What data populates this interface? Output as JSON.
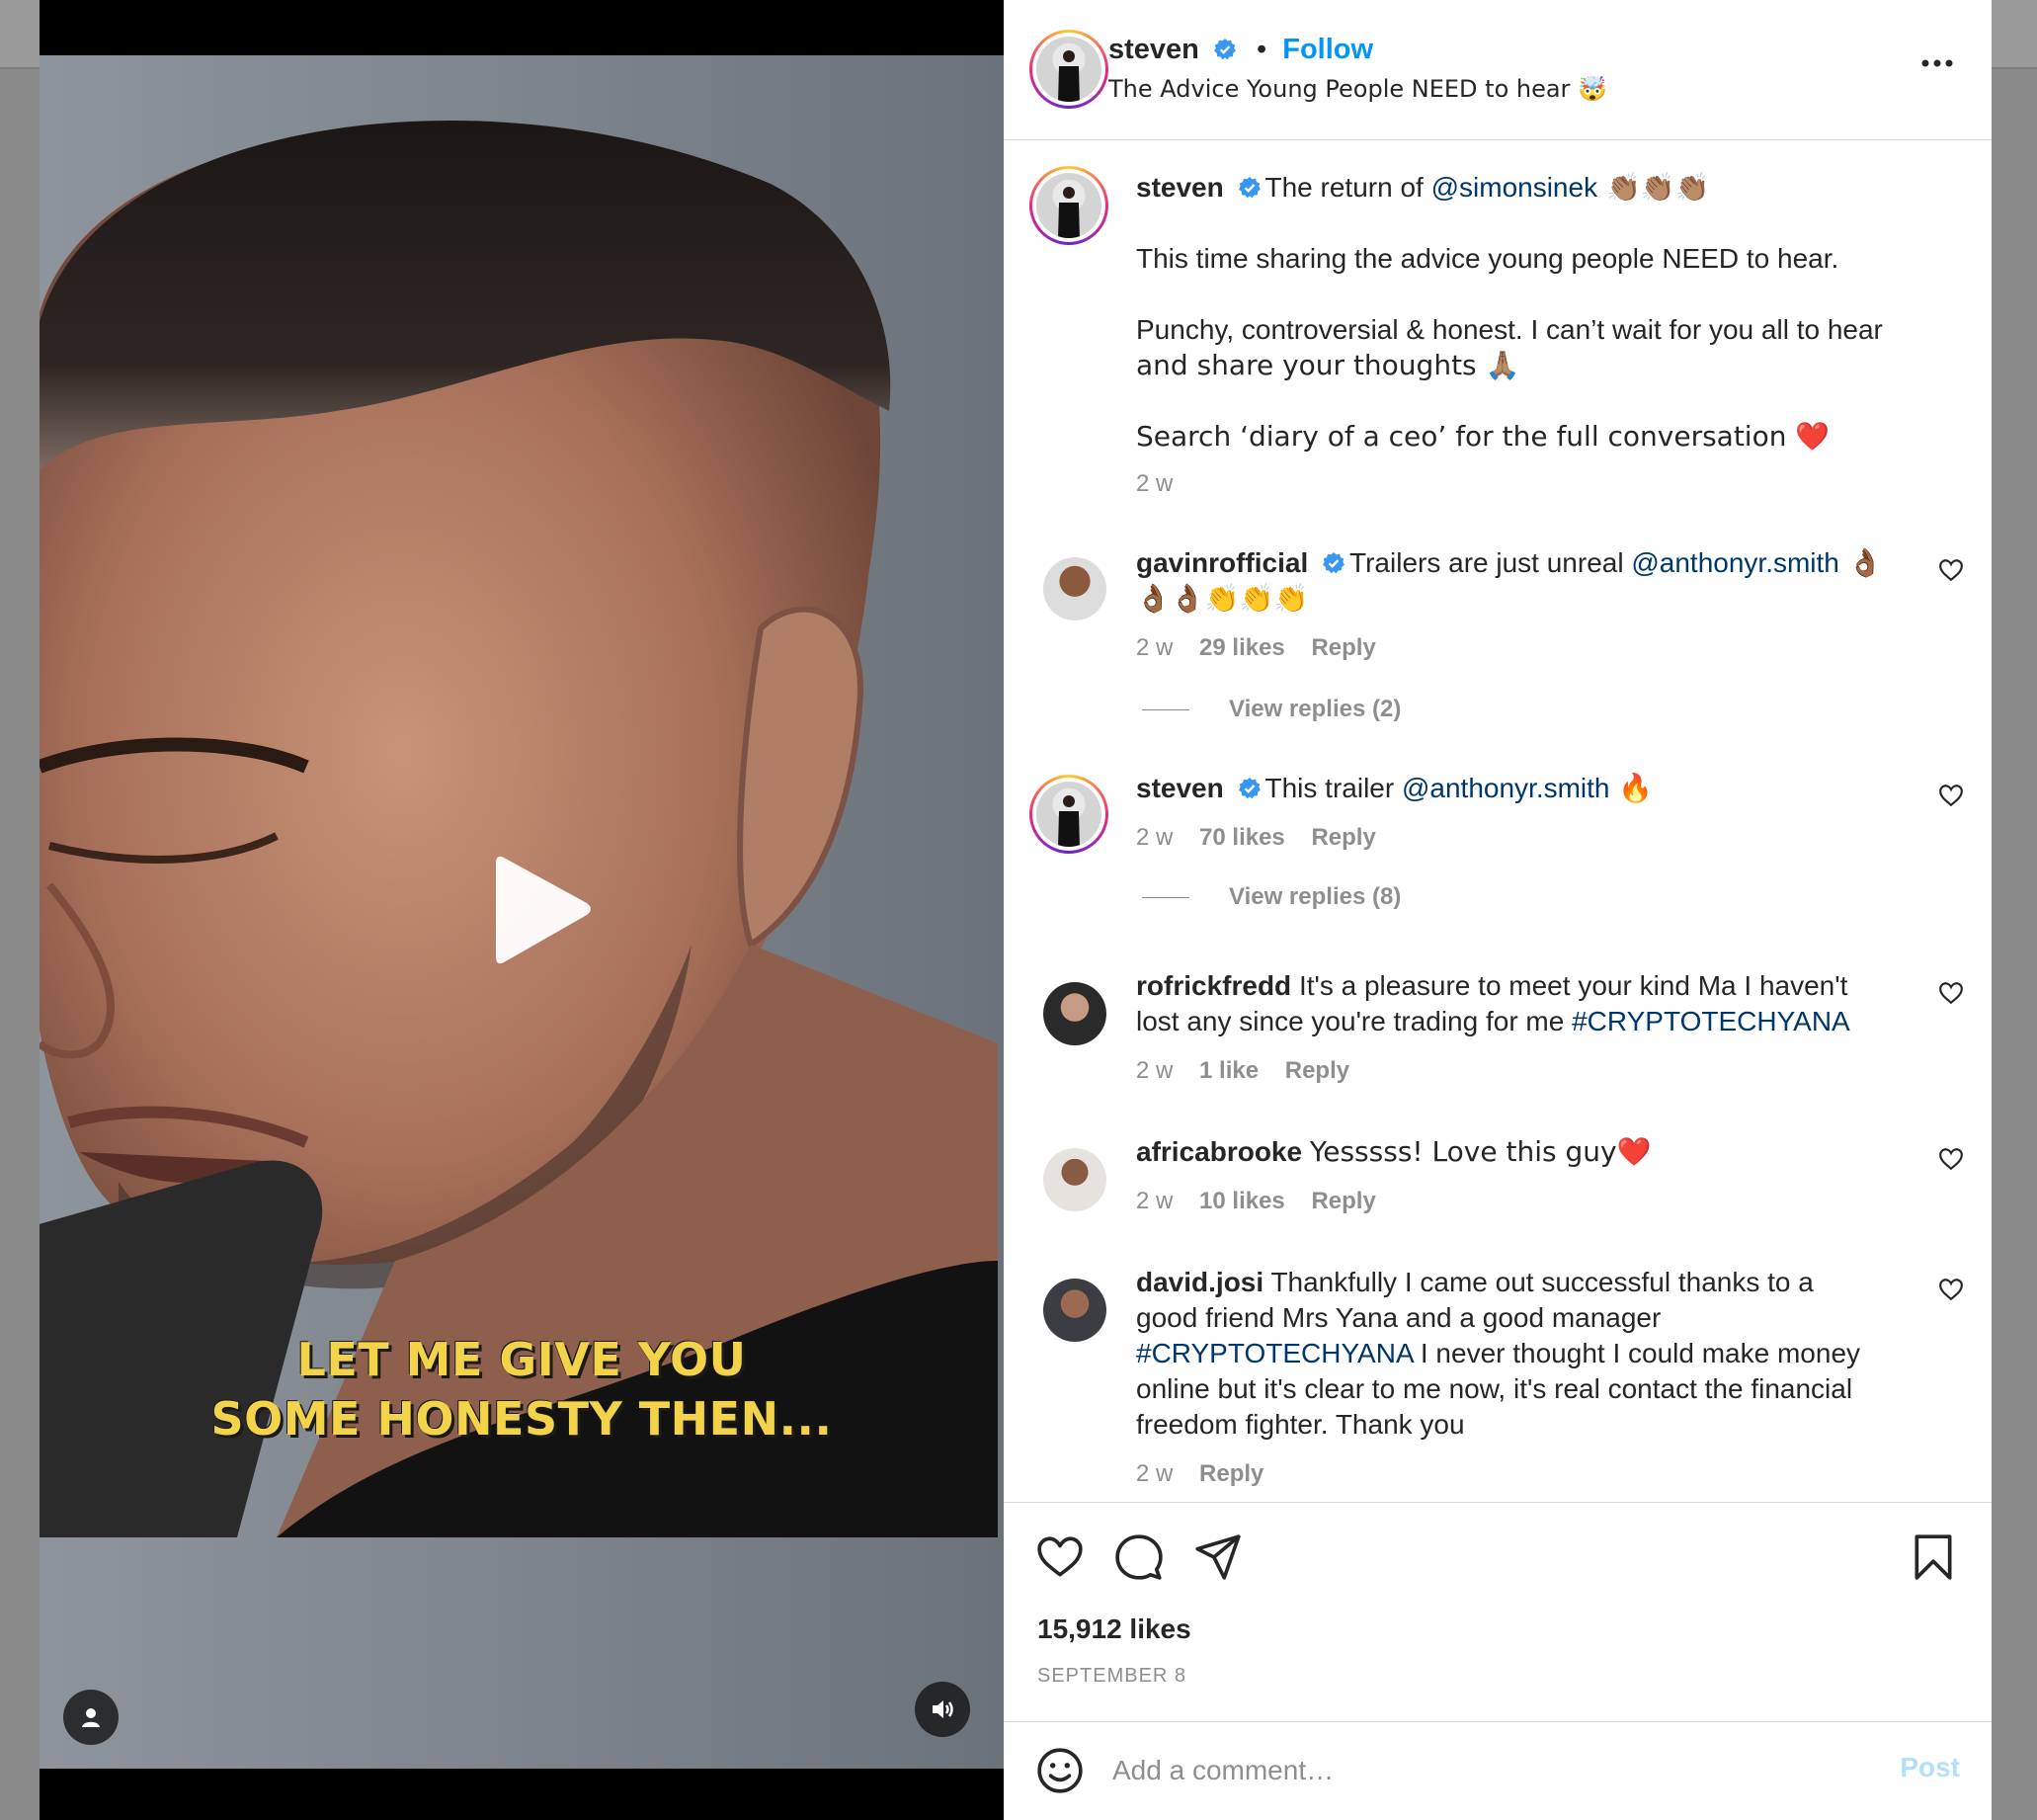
{
  "header": {
    "username": "steven",
    "separator": "•",
    "follow_label": "Follow",
    "audio_title": "The Advice Young People NEED to hear 🤯"
  },
  "video": {
    "overlay_line1": "LET ME GIVE YOU",
    "overlay_line2": "SOME HONESTY THEN..."
  },
  "caption": {
    "username": "steven",
    "line1_text": "The return of ",
    "line1_mention": "@simonsinek",
    "line1_emoji": " 👏🏽👏🏽👏🏽",
    "para1": "This time sharing the advice young people NEED to hear.",
    "para2a": "Punchy, controversial & honest. I can’t wait for you all to hear",
    "para2b": "and share your thoughts 🙏🏽",
    "para3": "Search ‘diary of a ceo’ for the full conversation ❤️",
    "time": "2 w"
  },
  "comments": [
    {
      "username": "gavinrofficial",
      "text": "Trailers are just unreal ",
      "mention": "@anthonyr.smith",
      "tail1": " 👌🏾",
      "tail2": "👌🏾👌🏾👏👏👏",
      "time": "2 w",
      "likes": "29 likes",
      "reply": "Reply",
      "view_replies": "View replies (2)"
    },
    {
      "username": "steven",
      "text": "This trailer ",
      "mention": "@anthonyr.smith",
      "tail1": " 🔥",
      "time": "2 w",
      "likes": "70 likes",
      "reply": "Reply",
      "view_replies": "View replies (8)"
    },
    {
      "username": "rofrickfredd",
      "line1": "It's a pleasure to meet your kind Ma I haven't",
      "line2": "lost any since you're trading for me ",
      "hashtag": "#CRYPTOTECHYANA",
      "time": "2 w",
      "likes": "1 like",
      "reply": "Reply"
    },
    {
      "username": "africabrooke",
      "text": "Yesssss! Love this guy❤️",
      "time": "2 w",
      "likes": "10 likes",
      "reply": "Reply"
    },
    {
      "username": "david.josi",
      "line1": "Thankfully I came out successful thanks to a",
      "line2": "good friend Mrs Yana and a good manager",
      "hashtag": "#CRYPTOTECHYANA",
      "line3": " I never thought I could make money",
      "line4": "online but it's clear to me now, it's real contact the financial",
      "line5": "freedom fighter. Thank you",
      "time": "2 w",
      "reply": "Reply"
    }
  ],
  "footer": {
    "likes": "15,912 likes",
    "date": "SEPTEMBER 8",
    "comment_placeholder": "Add a comment…",
    "post_label": "Post"
  },
  "colors": {
    "follow_blue": "#0095f6",
    "verified_blue": "#3897f0",
    "link_navy": "#00376b",
    "overlay_yellow": "#f2d34a"
  },
  "icons": [
    "play-icon",
    "user-tag-icon",
    "volume-icon",
    "verified-icon",
    "more-icon",
    "heart-icon",
    "comment-icon",
    "share-icon",
    "bookmark-icon",
    "emoji-icon"
  ]
}
